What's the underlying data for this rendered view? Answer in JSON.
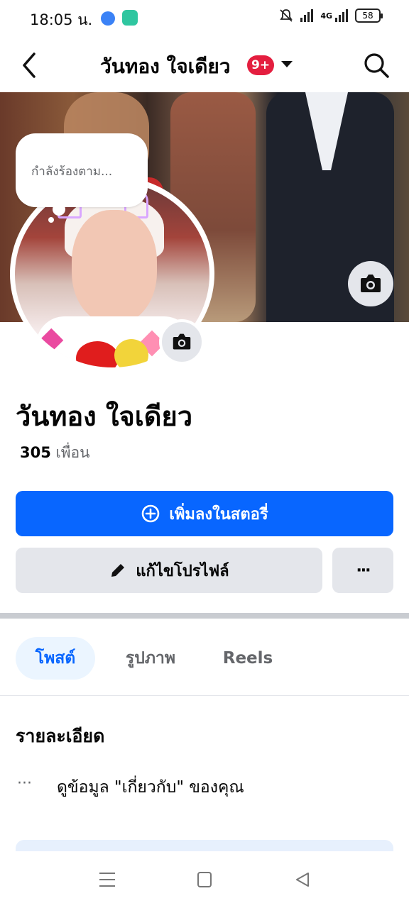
{
  "status_bar": {
    "time": "18:05 น.",
    "network": "4G",
    "battery": "58"
  },
  "header": {
    "title": "วันทอง ใจเดียว",
    "notification_badge": "9+"
  },
  "note": {
    "text": "กำลังร้องตาม..."
  },
  "profile": {
    "name": "วันทอง ใจเดียว",
    "friends_count": "305",
    "friends_label": "เพื่อน"
  },
  "actions": {
    "add_story_label": "เพิ่มลงในสตอรี่",
    "edit_profile_label": "แก้ไขโปรไฟล์",
    "more_label": "···"
  },
  "tabs": [
    {
      "label": "โพสต์",
      "active": true
    },
    {
      "label": "รูปภาพ",
      "active": false
    },
    {
      "label": "Reels",
      "active": false
    }
  ],
  "details": {
    "title": "รายละเอียด",
    "about_dots": "···",
    "about_text": "ดูข้อมูล \"เกี่ยวกับ\" ของคุณ"
  },
  "colors": {
    "primary": "#0866ff",
    "badge": "#e41e3f",
    "secondary_button": "#e4e6eb",
    "active_tab_bg": "#ebf5ff"
  }
}
